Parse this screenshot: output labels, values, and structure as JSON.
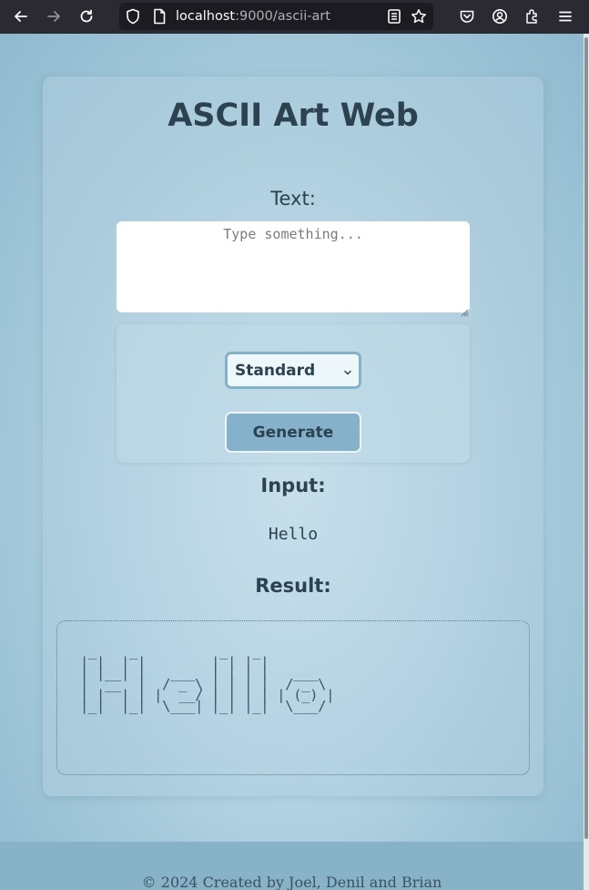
{
  "browser": {
    "url_host": "localhost",
    "url_rest": ":9000/ascii-art",
    "icons": [
      "back-arrow-icon",
      "forward-arrow-icon",
      "reload-icon",
      "shield-icon",
      "page-icon",
      "reader-view-icon",
      "bookmark-star-icon",
      "pocket-icon",
      "account-icon",
      "extensions-icon",
      "menu-icon"
    ]
  },
  "page": {
    "title": "ASCII Art Web",
    "text_label": "Text:",
    "textarea_placeholder": "Type something...",
    "textarea_value": "",
    "banner_select": {
      "selected": "Standard"
    },
    "generate_label": "Generate",
    "input_label": "Input:",
    "input_value": "Hello",
    "result_label": "Result:",
    "ascii_result": " _    _          _   _          \n| |  | |        | | | |         \n| |__| |   ___  | | | |   ___   \n|  __  |  / _ \\ | | | |  / _ \\  \n| |  | | |  __/ | | | | | (_) | \n|_|  |_|  \\___| |_| |_|  \\___/  ",
    "footer": "© 2024 Created by Joel, Denil and Brian"
  },
  "colors": {
    "accent": "#85b2ca",
    "text": "#2c4250",
    "footer_bg": "#87b2c8"
  }
}
